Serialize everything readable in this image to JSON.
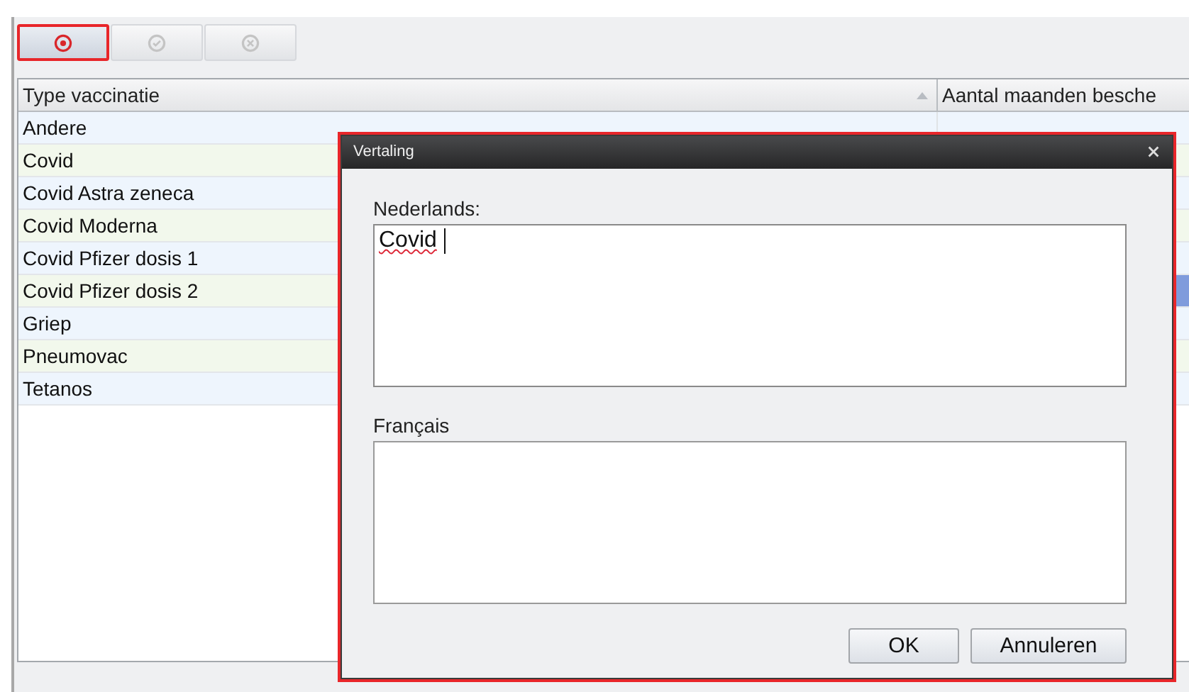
{
  "toolbar": {
    "buttons": [
      {
        "kind": "add",
        "disabled": false,
        "highlighted": true
      },
      {
        "kind": "confirm",
        "disabled": true,
        "highlighted": false
      },
      {
        "kind": "cancel",
        "disabled": true,
        "highlighted": false
      }
    ]
  },
  "table": {
    "columns": [
      {
        "label": "Type vaccinatie",
        "sorted": true
      },
      {
        "label": "Aantal maanden besche"
      }
    ],
    "rows": [
      {
        "cells": [
          "Andere"
        ],
        "selected": false
      },
      {
        "cells": [
          "Covid"
        ],
        "selected": false
      },
      {
        "cells": [
          "Covid Astra zeneca"
        ],
        "selected": false
      },
      {
        "cells": [
          "Covid Moderna"
        ],
        "selected": false
      },
      {
        "cells": [
          "Covid Pfizer dosis 1"
        ],
        "selected": false
      },
      {
        "cells": [
          "Covid Pfizer dosis 2"
        ],
        "selected": true
      },
      {
        "cells": [
          "Griep"
        ],
        "selected": false
      },
      {
        "cells": [
          "Pneumovac"
        ],
        "selected": false
      },
      {
        "cells": [
          "Tetanos"
        ],
        "selected": false
      }
    ]
  },
  "dialog": {
    "title": "Vertaling",
    "highlighted": true,
    "fields": [
      {
        "label": "Nederlands:",
        "value": "Covid",
        "spelling_error": true,
        "focused": true
      },
      {
        "label": "Français",
        "focused": false
      }
    ],
    "buttons": [
      {
        "label": "OK"
      },
      {
        "label": "Annuleren"
      }
    ]
  }
}
